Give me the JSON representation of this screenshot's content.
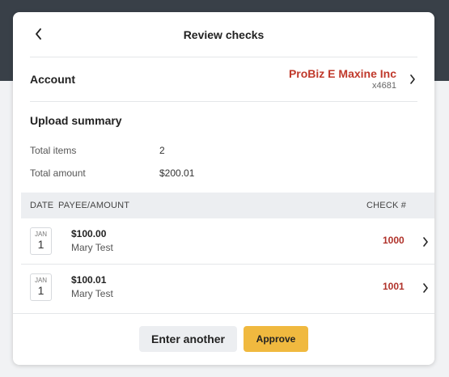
{
  "header": {
    "title": "Review checks"
  },
  "account": {
    "label": "Account",
    "name": "ProBiz E Maxine Inc",
    "number": "x4681"
  },
  "summary": {
    "title": "Upload summary",
    "total_items_label": "Total items",
    "total_items_value": "2",
    "total_amount_label": "Total amount",
    "total_amount_value": "$200.01"
  },
  "table": {
    "col_date": "DATE",
    "col_payee": "PAYEE/AMOUNT",
    "col_check": "CHECK #",
    "rows": [
      {
        "month": "JAN",
        "day": "1",
        "amount": "$100.00",
        "payee": "Mary Test",
        "check": "1000"
      },
      {
        "month": "JAN",
        "day": "1",
        "amount": "$100.01",
        "payee": "Mary Test",
        "check": "1001"
      }
    ]
  },
  "footer": {
    "secondary_label": "Enter another",
    "primary_label": "Approve"
  },
  "colors": {
    "accent": "#f0b93f",
    "account_name": "#c0392b",
    "check_number": "#b0322a",
    "backdrop": "#394048"
  },
  "icons": {
    "back": "chevron-left-icon",
    "next": "chevron-right-icon"
  }
}
